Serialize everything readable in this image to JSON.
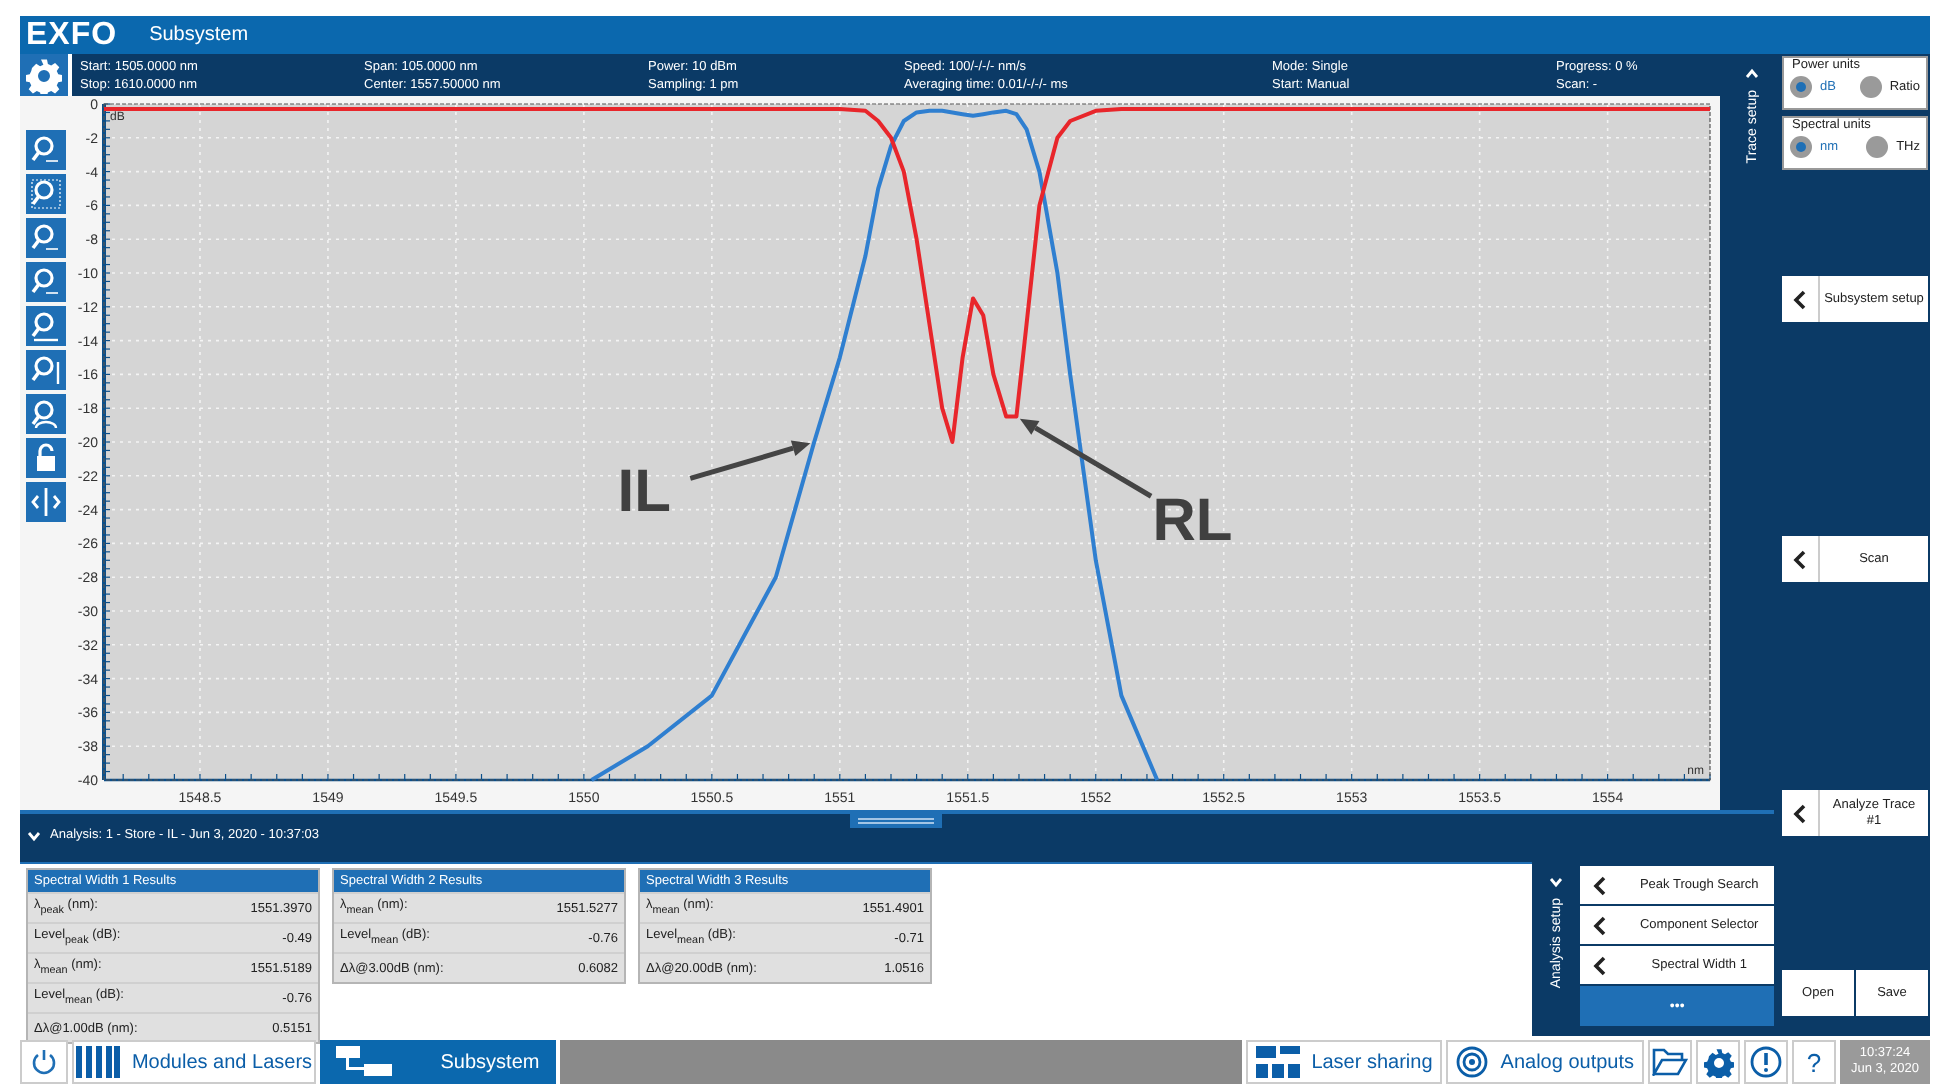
{
  "header": {
    "logo": "EXFO",
    "title": "Subsystem"
  },
  "info": [
    {
      "line1": "Start: 1505.0000 nm",
      "line2": "Stop: 1610.0000 nm"
    },
    {
      "line1": "Span: 105.0000 nm",
      "line2": "Center: 1557.50000 nm"
    },
    {
      "line1": "Power: 10 dBm",
      "line2": "Sampling: 1 pm"
    },
    {
      "line1": "Speed: 100/-/-/- nm/s",
      "line2": "Averaging time: 0.01/-/-/- ms"
    },
    {
      "line1": "Mode: Single",
      "line2": "Start: Manual"
    },
    {
      "line1": "Progress: 0 %",
      "line2": "Scan: -"
    }
  ],
  "chart_tools": [
    {
      "kind": "zoom-one"
    },
    {
      "kind": "zoom-box"
    },
    {
      "kind": "zoom-all"
    },
    {
      "kind": "zoom-auto"
    },
    {
      "kind": "zoom-x"
    },
    {
      "kind": "zoom-y"
    },
    {
      "kind": "zoom-reset"
    },
    {
      "kind": "lock"
    },
    {
      "kind": "cursor"
    }
  ],
  "chart": {
    "chart_data": {
      "type": "line",
      "xlabel": "nm",
      "ylabel": "dB",
      "x": [
        1548.125,
        1549,
        1550,
        1550.03,
        1550.25,
        1550.5,
        1550.75,
        1550.9,
        1551,
        1551.1,
        1551.15,
        1551.2,
        1551.25,
        1551.3,
        1551.35,
        1551.4,
        1551.44,
        1551.48,
        1551.52,
        1551.56,
        1551.6,
        1551.65,
        1551.69,
        1551.73,
        1551.78,
        1551.85,
        1551.9,
        1552,
        1552.1,
        1552.24,
        1552.5,
        1553,
        1554.4
      ],
      "series": [
        {
          "color": "#2f7fd0",
          "values": [
            null,
            null,
            null,
            -40,
            -38,
            -35,
            -28,
            -20,
            -15,
            -9,
            -5,
            -2.5,
            -1,
            -0.5,
            -0.4,
            -0.4,
            -0.5,
            -0.6,
            -0.7,
            -0.6,
            -0.5,
            -0.4,
            -0.6,
            -1.5,
            -4,
            -10,
            -16,
            -27,
            -35,
            -40,
            null,
            null,
            null
          ]
        },
        {
          "color": "#e8262b",
          "values": [
            -0.3,
            -0.3,
            -0.3,
            -0.3,
            -0.3,
            -0.3,
            -0.3,
            -0.3,
            -0.3,
            -0.4,
            -1,
            -2,
            -4,
            -8,
            -13,
            -18,
            -20,
            -15,
            -11.5,
            -12.5,
            -16,
            -18.5,
            -18.5,
            -13,
            -6,
            -2,
            -1,
            -0.4,
            -0.3,
            -0.3,
            -0.3,
            -0.3,
            -0.3
          ]
        }
      ],
      "xlim": [
        1548.125,
        1554.4
      ],
      "ylim": [
        -40,
        0
      ],
      "xticks": [
        1548.5,
        1549,
        1549.5,
        1550,
        1550.5,
        1551,
        1551.5,
        1552,
        1552.5,
        1553,
        1553.5,
        1554
      ],
      "yticks": [
        0,
        -2,
        -4,
        -6,
        -8,
        -10,
        -12,
        -14,
        -16,
        -18,
        -20,
        -22,
        -24,
        -26,
        -28,
        -30,
        -32,
        -34,
        -36,
        -38,
        -40
      ],
      "grid": true,
      "annotations": [
        {
          "text": "IL",
          "x": 1550.9,
          "y": -20
        },
        {
          "text": "RL",
          "x": 1551.69,
          "y": -18.5
        }
      ]
    }
  },
  "trace_setup": {
    "label": "Trace setup"
  },
  "analysis": {
    "title": "Analysis: 1 - Store - IL - Jun 3, 2020 - 10:37:03",
    "results": [
      {
        "title": "Spectral Width 1 Results",
        "rows": [
          {
            "label": "λ$_{peak}$ (nm):",
            "value": "1551.3970"
          },
          {
            "label": "Level$_{peak}$ (dB):",
            "value": "-0.49"
          },
          {
            "label": "λ$_{mean}$ (nm):",
            "value": "1551.5189"
          },
          {
            "label": "Level$_{mean}$ (dB):",
            "value": "-0.76"
          },
          {
            "label": "Δλ@1.00dB (nm):",
            "value": "0.5151"
          }
        ]
      },
      {
        "title": "Spectral Width 2 Results",
        "rows": [
          {
            "label": "λ$_{mean}$ (nm):",
            "value": "1551.5277"
          },
          {
            "label": "Level$_{mean}$ (dB):",
            "value": "-0.76"
          },
          {
            "label": "Δλ@3.00dB (nm):",
            "value": "0.6082"
          }
        ]
      },
      {
        "title": "Spectral Width 3 Results",
        "rows": [
          {
            "label": "λ$_{mean}$ (nm):",
            "value": "1551.4901"
          },
          {
            "label": "Level$_{mean}$ (dB):",
            "value": "-0.71"
          },
          {
            "label": "Δλ@20.00dB (nm):",
            "value": "1.0516"
          }
        ]
      }
    ],
    "setup_label": "Analysis setup",
    "steps": [
      "Peak Trough Search",
      "Component Selector",
      "Spectral Width 1"
    ],
    "more": "•••"
  },
  "side": {
    "power_units": {
      "legend": "Power units",
      "options": [
        {
          "label": "dB",
          "selected": true
        },
        {
          "label": "Ratio",
          "selected": false
        }
      ]
    },
    "spectral_units": {
      "legend": "Spectral units",
      "options": [
        {
          "label": "nm",
          "selected": true
        },
        {
          "label": "THz",
          "selected": false
        }
      ]
    },
    "subsystem_setup": "Subsystem setup",
    "scan": "Scan",
    "analyze": "Analyze Trace #1",
    "open": "Open",
    "save": "Save"
  },
  "taskbar": {
    "tabs": [
      {
        "label": "Modules and Lasers",
        "kind": "modules",
        "selected": false
      },
      {
        "label": "Subsystem",
        "kind": "subsystem",
        "selected": true
      }
    ],
    "tools": [
      {
        "label": "Laser sharing",
        "kind": "laser"
      },
      {
        "label": "Analog outputs",
        "kind": "analog"
      }
    ],
    "help": "?",
    "time": "10:37:24",
    "date": "Jun 3, 2020"
  }
}
